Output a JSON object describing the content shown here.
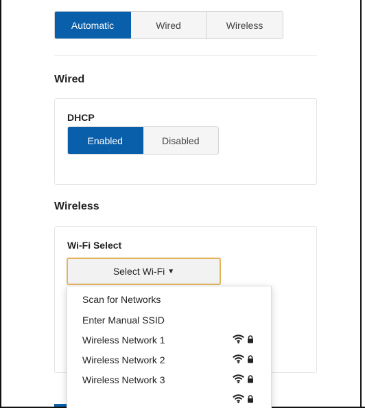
{
  "mode_selector": {
    "options": [
      "Automatic",
      "Wired",
      "Wireless"
    ],
    "selected": "Automatic"
  },
  "wired": {
    "heading": "Wired",
    "dhcp": {
      "label": "DHCP",
      "options": [
        "Enabled",
        "Disabled"
      ],
      "selected": "Enabled"
    }
  },
  "wireless": {
    "heading": "Wireless",
    "wifi_select": {
      "label": "Wi-Fi Select",
      "button_label": "Select Wi-Fi"
    }
  },
  "wifi_menu": {
    "items": [
      {
        "label": "Scan for Networks"
      },
      {
        "label": "Enter Manual SSID"
      },
      {
        "label": "Wireless Network 1",
        "icons": [
          "wifi-icon",
          "lock-icon"
        ]
      },
      {
        "label": "Wireless Network 2",
        "icons": [
          "wifi-icon",
          "lock-icon"
        ]
      },
      {
        "label": "Wireless Network 3",
        "icons": [
          "wifi-icon",
          "lock-icon"
        ]
      },
      {
        "label": "",
        "icons": [
          "wifi-icon",
          "lock-icon"
        ]
      }
    ]
  },
  "colors": {
    "accent": "#0a5faa",
    "focus_border": "#e3b35a"
  }
}
